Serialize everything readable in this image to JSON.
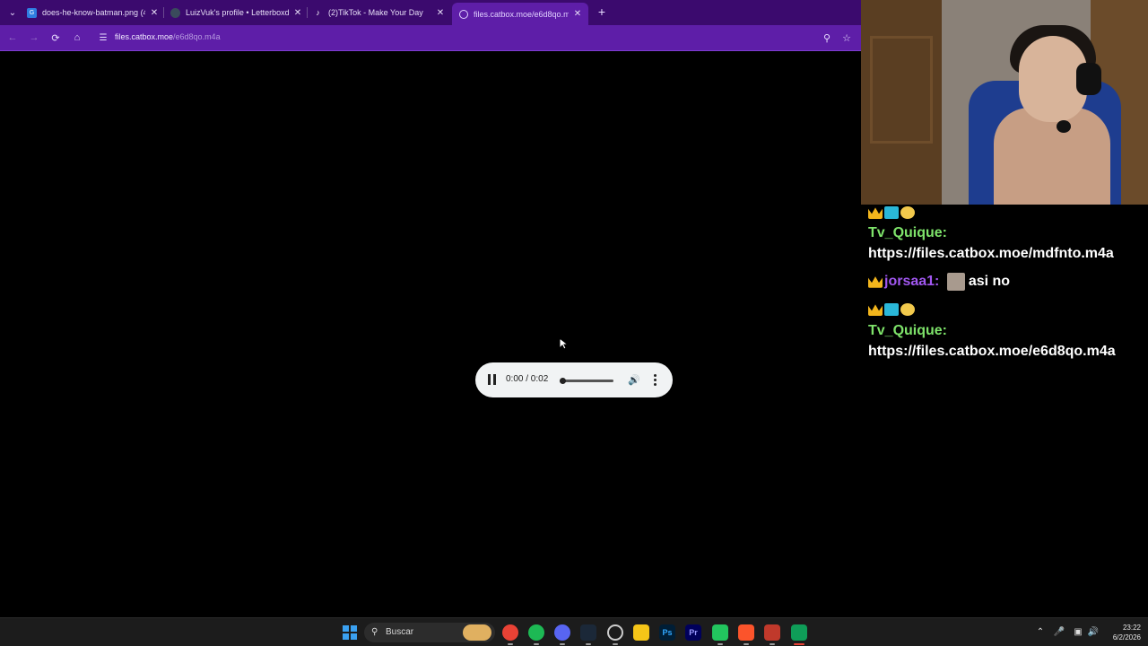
{
  "browser": {
    "tabs": [
      {
        "title": "does-he-know-batman.png (49",
        "favicon": "gif-icon",
        "active": false
      },
      {
        "title": "LuizVuk's profile • Letterboxd",
        "favicon": "letterboxd-icon",
        "active": false
      },
      {
        "title": "(2)TikTok - Make Your Day",
        "favicon": "tiktok-icon",
        "active": false
      },
      {
        "title": "files.catbox.moe/e6d8qo.m",
        "favicon": "globe-icon",
        "active": true
      }
    ],
    "url": {
      "host": "files.catbox.moe",
      "path": "/e6d8qo.m4a"
    },
    "theme_color": "#5e1ea8"
  },
  "player": {
    "time": "0:00 / 0:02",
    "progress": 0.0,
    "state": "playing"
  },
  "chat": {
    "messages": [
      {
        "user": "Tv_Quique:",
        "text": " https://files.catbox.moe/mdfnto.m4a",
        "user_color": "#7ee36a"
      },
      {
        "user": "jorsaa1:",
        "text": "asi no",
        "user_color": "#a157f0"
      },
      {
        "user": "Tv_Quique:",
        "text": " https://files.catbox.moe/e6d8qo.m4a",
        "user_color": "#7ee36a"
      }
    ]
  },
  "taskbar": {
    "search_label": "Buscar",
    "time": "23:22",
    "date": "6/2/2026",
    "apps": [
      "photoshop-icon",
      "premiere-icon"
    ]
  }
}
